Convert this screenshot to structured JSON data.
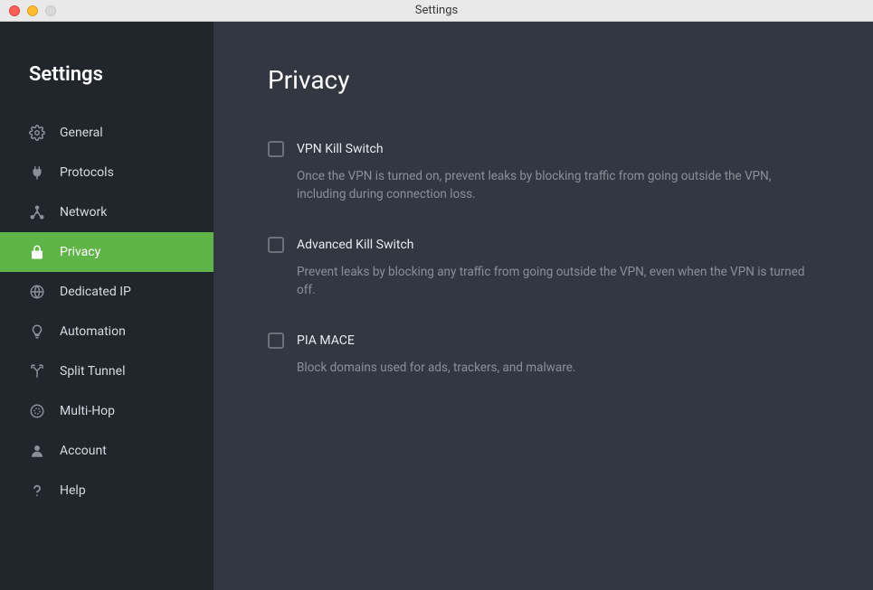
{
  "window": {
    "title": "Settings"
  },
  "sidebar": {
    "title": "Settings",
    "items": [
      {
        "label": "General",
        "icon": "gear-icon",
        "active": false
      },
      {
        "label": "Protocols",
        "icon": "plug-icon",
        "active": false
      },
      {
        "label": "Network",
        "icon": "network-icon",
        "active": false
      },
      {
        "label": "Privacy",
        "icon": "lock-icon",
        "active": true
      },
      {
        "label": "Dedicated IP",
        "icon": "globe-ip-icon",
        "active": false
      },
      {
        "label": "Automation",
        "icon": "lightbulb-icon",
        "active": false
      },
      {
        "label": "Split Tunnel",
        "icon": "split-icon",
        "active": false
      },
      {
        "label": "Multi-Hop",
        "icon": "hop-icon",
        "active": false
      },
      {
        "label": "Account",
        "icon": "person-icon",
        "active": false
      },
      {
        "label": "Help",
        "icon": "question-icon",
        "active": false
      }
    ]
  },
  "page": {
    "title": "Privacy"
  },
  "options": [
    {
      "key": "kill-switch",
      "label": "VPN Kill Switch",
      "desc": "Once the VPN is turned on, prevent leaks by blocking traffic from going outside the VPN, including during connection loss.",
      "checked": false
    },
    {
      "key": "advanced-kill-switch",
      "label": "Advanced Kill Switch",
      "desc": "Prevent leaks by blocking any traffic from going outside the VPN, even when the VPN is turned off.",
      "checked": false
    },
    {
      "key": "pia-mace",
      "label": "PIA MACE",
      "desc": "Block domains used for ads, trackers, and malware.",
      "checked": false
    }
  ]
}
